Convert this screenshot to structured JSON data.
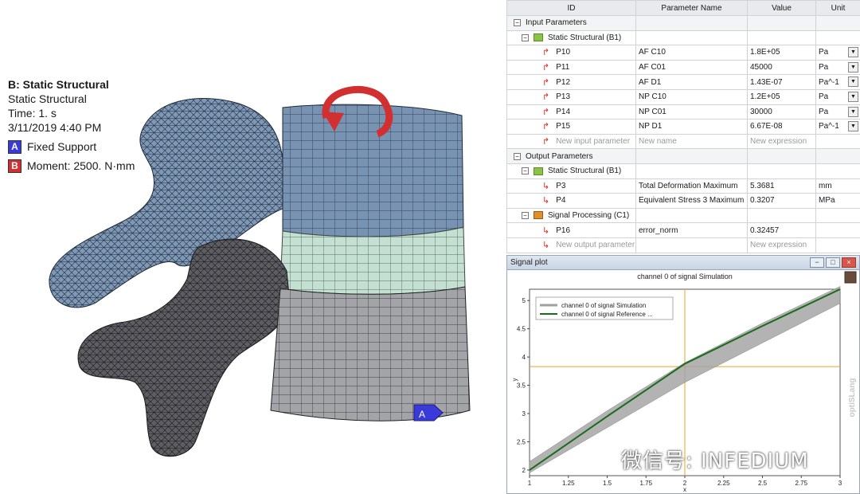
{
  "model": {
    "title": "B: Static Structural",
    "analysis_type": "Static Structural",
    "time": "Time: 1. s",
    "date": "3/11/2019 4:40 PM",
    "legend": [
      {
        "key": "A",
        "label": "Fixed Support",
        "color": "#3a3ad9"
      },
      {
        "key": "B",
        "label": "Moment: 2500. N·mm",
        "color": "#d23030"
      }
    ],
    "support_marker": "A"
  },
  "param_table": {
    "headers": {
      "id": "ID",
      "name": "Parameter Name",
      "value": "Value",
      "unit": "Unit"
    },
    "input_section": "Input Parameters",
    "input_system": "Static Structural (B1)",
    "inputs": [
      {
        "id": "P10",
        "name": "AF C10",
        "value": "1.8E+05",
        "unit": "Pa"
      },
      {
        "id": "P11",
        "name": "AF C01",
        "value": "45000",
        "unit": "Pa"
      },
      {
        "id": "P12",
        "name": "AF D1",
        "value": "1.43E-07",
        "unit": "Pa^-1"
      },
      {
        "id": "P13",
        "name": "NP C10",
        "value": "1.2E+05",
        "unit": "Pa"
      },
      {
        "id": "P14",
        "name": "NP C01",
        "value": "30000",
        "unit": "Pa"
      },
      {
        "id": "P15",
        "name": "NP D1",
        "value": "6.67E-08",
        "unit": "Pa^-1"
      }
    ],
    "new_input": {
      "id": "New input parameter",
      "name": "New name",
      "value": "New expression"
    },
    "output_section": "Output Parameters",
    "output_system": "Static Structural (B1)",
    "outputs": [
      {
        "id": "P3",
        "name": "Total Deformation Maximum",
        "value": "5.3681",
        "unit": "mm"
      },
      {
        "id": "P4",
        "name": "Equivalent Stress 3 Maximum",
        "value": "0.3207",
        "unit": "MPa"
      }
    ],
    "signal_system": "Signal Processing (C1)",
    "signal_outputs": [
      {
        "id": "P16",
        "name": "error_norm",
        "value": "0.32457",
        "unit": ""
      }
    ],
    "new_output": {
      "id": "New output parameter",
      "value": "New expression"
    }
  },
  "signal_plot": {
    "window_title": "Signal plot",
    "side_label": "optiSLang"
  },
  "chart_data": {
    "type": "line",
    "title": "channel 0 of signal Simulation",
    "xlabel": "x",
    "ylabel": "y",
    "xlim": [
      1,
      3
    ],
    "ylim": [
      1.9,
      5.2
    ],
    "xticks": [
      "1",
      "1.25",
      "1.5",
      "1.75",
      "2",
      "2.25",
      "2.5",
      "2.75",
      "3"
    ],
    "yticks": [
      "2",
      "2.5",
      "3",
      "3.5",
      "4",
      "4.5",
      "5"
    ],
    "series": [
      {
        "name": "channel 0 of signal Simulation",
        "color": "#a0a0a0",
        "x": [
          1,
          1.5,
          2,
          2.5,
          3
        ],
        "y_lower": [
          1.95,
          2.75,
          3.55,
          4.25,
          4.95
        ],
        "y_upper": [
          2.15,
          3.05,
          3.9,
          4.6,
          5.25
        ]
      },
      {
        "name": "channel 0 of signal Reference ...",
        "color": "#1a6b1a",
        "x": [
          1,
          1.5,
          2,
          2.5,
          3
        ],
        "y": [
          2.0,
          2.95,
          3.88,
          4.55,
          5.2
        ]
      }
    ],
    "crosshair": {
      "x": 2,
      "y": 3.83,
      "color": "#f0a020"
    },
    "legend_position": "top-left",
    "grid": false
  },
  "watermark": "微信号: INFEDIUM"
}
